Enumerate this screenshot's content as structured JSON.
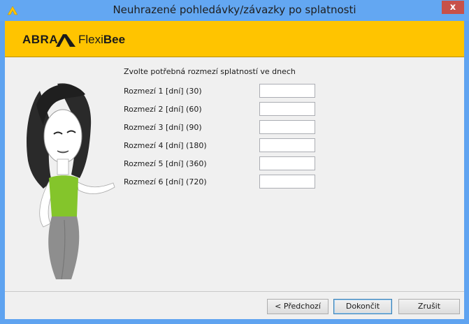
{
  "window": {
    "title": "Neuhrazené pohledávky/závazky po splatnosti",
    "close_label": "x"
  },
  "banner": {
    "brand_abra": "ABRA",
    "brand_flexi": "Flexi",
    "brand_bee": "Bee",
    "colors": {
      "banner": "#ffc400"
    }
  },
  "form": {
    "heading": "Zvolte potřebná rozmezí splatností ve dnech",
    "rows": [
      {
        "label": "Rozmezí 1 [dní] (30)",
        "value": ""
      },
      {
        "label": "Rozmezí 2 [dní] (60)",
        "value": ""
      },
      {
        "label": "Rozmezí 3 [dní] (90)",
        "value": ""
      },
      {
        "label": "Rozmezí 4 [dní] (180)",
        "value": ""
      },
      {
        "label": "Rozmezí 5 [dní] (360)",
        "value": ""
      },
      {
        "label": "Rozmezí 6 [dní] (720)",
        "value": ""
      }
    ]
  },
  "buttons": {
    "back": "< Předchozí",
    "finish": "Dokončit",
    "cancel": "Zrušit"
  }
}
